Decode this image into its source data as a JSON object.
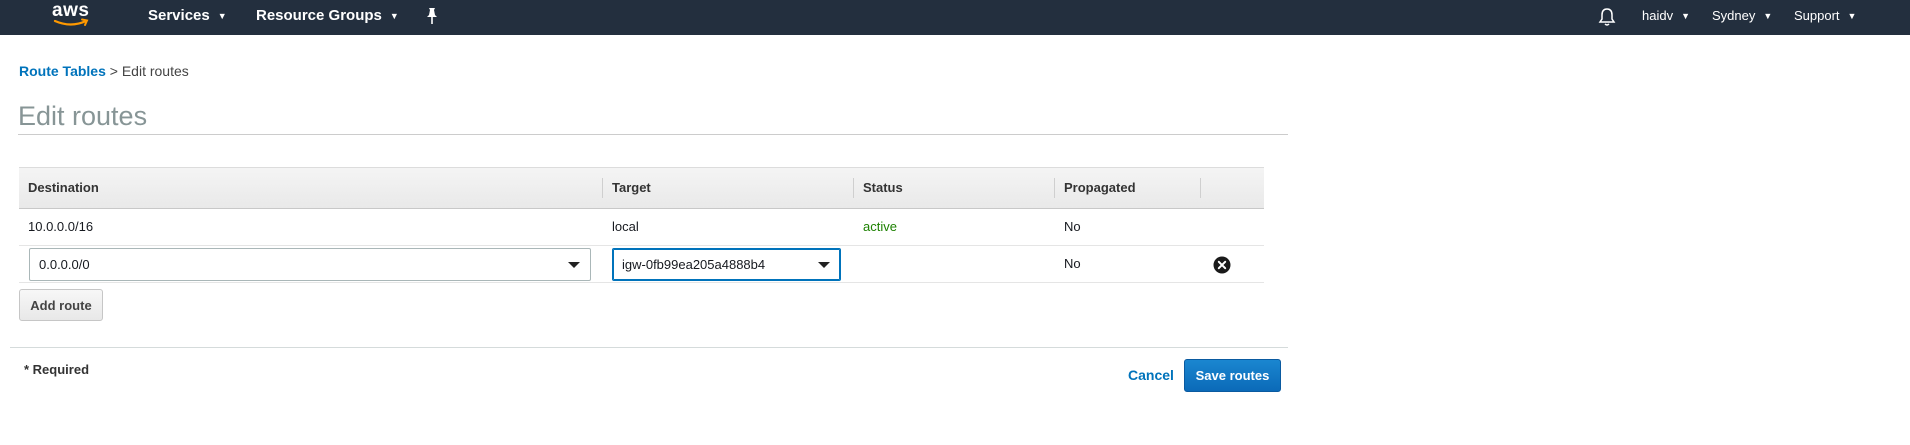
{
  "topnav": {
    "logo_text": "aws",
    "services_label": "Services",
    "resource_groups_label": "Resource Groups",
    "user_label": "haidv",
    "region_label": "Sydney",
    "support_label": "Support"
  },
  "breadcrumb": {
    "parent_label": "Route Tables",
    "separator": ">",
    "current_label": "Edit routes"
  },
  "page_title": "Edit routes",
  "table": {
    "headers": {
      "destination": "Destination",
      "target": "Target",
      "status": "Status",
      "propagated": "Propagated"
    },
    "static_route": {
      "destination": "10.0.0.0/16",
      "target": "local",
      "status": "active",
      "propagated": "No"
    },
    "editable_route": {
      "destination_value": "0.0.0.0/0",
      "target_value": "igw-0fb99ea205a4888b4",
      "status": "",
      "propagated": "No"
    }
  },
  "add_route_label": "Add route",
  "footer": {
    "required_label": "* Required",
    "cancel_label": "Cancel",
    "save_label": "Save routes"
  },
  "colors": {
    "nav_bg": "#232f3e",
    "link": "#0073bb",
    "status_active": "#1d8102",
    "primary_button": "#0b6ab8"
  },
  "icons": [
    "aws-smile-logo",
    "pin-icon",
    "bell-icon",
    "chevron-down-icon",
    "remove-circle-icon"
  ]
}
